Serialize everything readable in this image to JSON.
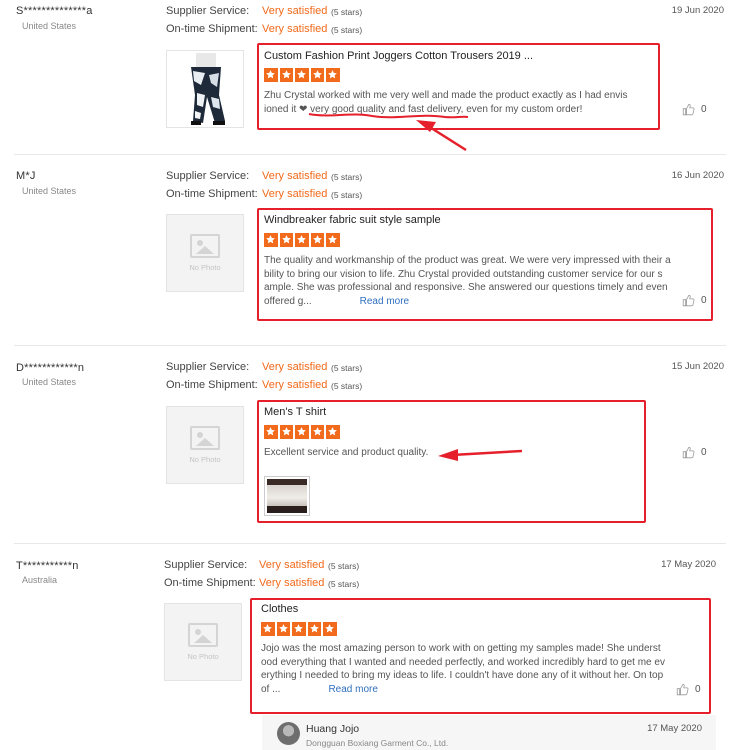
{
  "reviews": [
    {
      "buyer": "S**************a",
      "country": "United States",
      "supplier_label": "Supplier Service:",
      "supplier_value": "Very satisfied",
      "supplier_note": "(5 stars)",
      "shipment_label": "On-time Shipment:",
      "shipment_value": "Very satisfied",
      "shipment_note": "(5 stars)",
      "date": "19 Jun 2020",
      "product_title": "Custom Fashion Print Joggers Cotton Trousers 2019 ...",
      "rating": 5,
      "text_lines": [
        "Zhu Crystal worked with me very well and made the product exactly as I had envis",
        "ioned it ❤ very good quality and fast delivery, even for my custom order!"
      ],
      "likes": "0"
    },
    {
      "buyer": "M*J",
      "country": "United States",
      "supplier_label": "Supplier Service:",
      "supplier_value": "Very satisfied",
      "supplier_note": "(5 stars)",
      "shipment_label": "On-time Shipment:",
      "shipment_value": "Very satisfied",
      "shipment_note": "(5 stars)",
      "date": "16 Jun 2020",
      "no_photo": "No Photo",
      "product_title": "Windbreaker fabric suit style sample",
      "rating": 5,
      "text_lines": [
        "The quality and workmanship of the product was great. We were very impressed with their a",
        "bility to bring our vision to life. Zhu Crystal provided outstanding customer service for our s",
        "ample. She was professional and responsive. She answered our questions timely and even",
        "offered g..."
      ],
      "read_more": "Read more",
      "likes": "0"
    },
    {
      "buyer": "D************n",
      "country": "United States",
      "supplier_label": "Supplier Service:",
      "supplier_value": "Very satisfied",
      "supplier_note": "(5 stars)",
      "shipment_label": "On-time Shipment:",
      "shipment_value": "Very satisfied",
      "shipment_note": "(5 stars)",
      "date": "15 Jun 2020",
      "no_photo": "No Photo",
      "product_title": "Men's T shirt",
      "rating": 5,
      "text_lines": [
        "Excellent service and product quality."
      ],
      "likes": "0"
    },
    {
      "buyer": "T***********n",
      "country": "Australia",
      "supplier_label": "Supplier Service:",
      "supplier_value": "Very satisfied",
      "supplier_note": "(5 stars)",
      "shipment_label": "On-time Shipment:",
      "shipment_value": "Very satisfied",
      "shipment_note": "(5 stars)",
      "date": "17 May 2020",
      "no_photo": "No Photo",
      "product_title": "Clothes",
      "rating": 5,
      "text_lines": [
        "Jojo was the most amazing person to work with on getting my samples made! She underst",
        "ood everything that I wanted and needed perfectly, and worked incredibly hard to get me ev",
        "erything I needed to bring my ideas to life. I couldn't have done any of it without her. On top",
        "of ..."
      ],
      "read_more": "Read more",
      "likes": "0"
    }
  ],
  "reply": {
    "name": "Huang Jojo",
    "company": "Dongguan Boxiang Garment Co., Ltd.",
    "date": "17 May 2020"
  },
  "colors": {
    "accent": "#f26a1b",
    "annotation": "#e5202c",
    "link": "#2f6fbf"
  }
}
